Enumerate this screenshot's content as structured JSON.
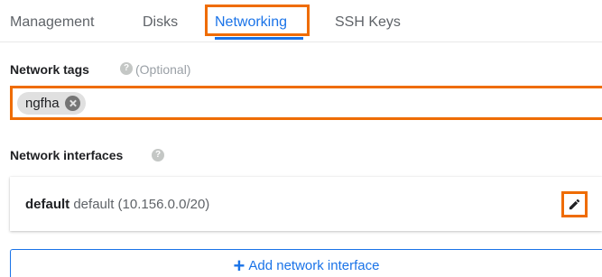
{
  "tabs": [
    {
      "label": "Management"
    },
    {
      "label": "Disks"
    },
    {
      "label": "Networking"
    },
    {
      "label": "SSH Keys"
    }
  ],
  "active_tab": "Networking",
  "network_tags": {
    "label": "Network tags",
    "help_icon": "?",
    "optional_text": "(Optional)",
    "tags": [
      "ngfha"
    ]
  },
  "network_interfaces": {
    "label": "Network interfaces",
    "help_icon": "?",
    "items": [
      {
        "name": "default",
        "detail": "default (10.156.0.0/20)"
      }
    ],
    "add_button_label": "Add network interface",
    "add_icon": "+"
  },
  "colors": {
    "accent": "#1a73e8",
    "highlight": "#ef6c00",
    "chip_bg": "#e0e0e0",
    "muted_text": "#5f6368"
  }
}
